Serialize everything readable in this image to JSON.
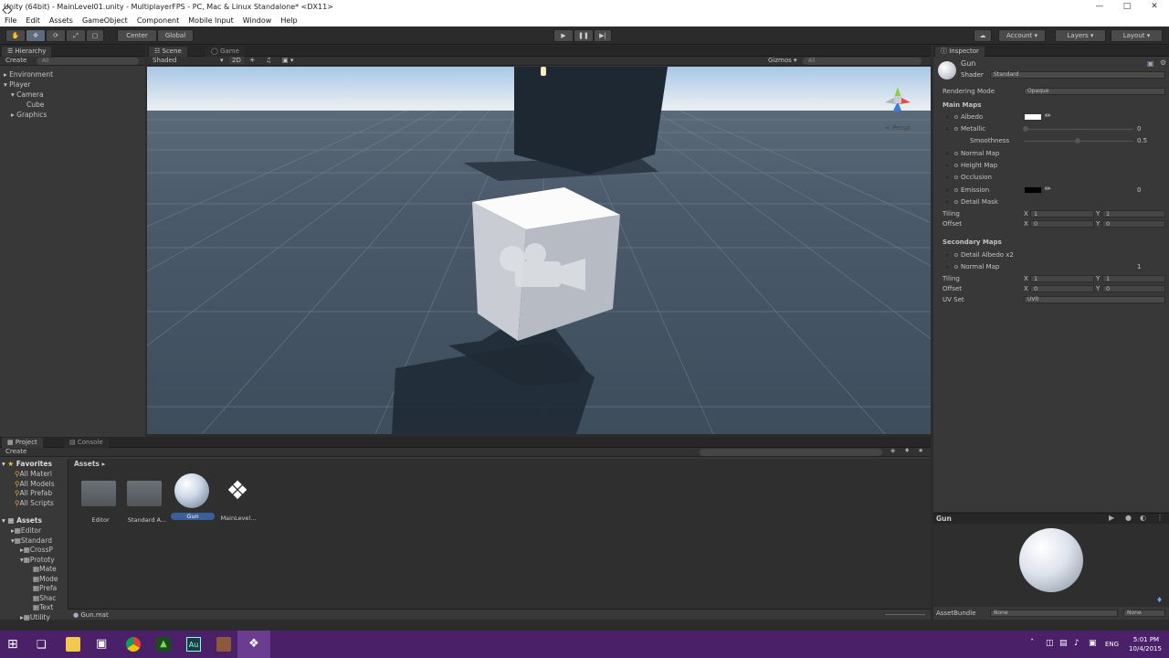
{
  "window": {
    "title": "Unity (64bit) - MainLevel01.unity - MultiplayerFPS - PC, Mac & Linux Standalone* <DX11>"
  },
  "menu": [
    "File",
    "Edit",
    "Assets",
    "GameObject",
    "Component",
    "Mobile Input",
    "Window",
    "Help"
  ],
  "toolbar": {
    "center_label": "Center",
    "global_label": "Global",
    "account_label": "Account",
    "layers_label": "Layers",
    "layout_label": "Layout"
  },
  "hierarchy": {
    "tab": "Hierarchy",
    "create": "Create",
    "search_placeholder": "All",
    "items": [
      "Environment",
      "Player",
      "Camera",
      "Cube",
      "Graphics"
    ]
  },
  "scene": {
    "tab_scene": "Scene",
    "tab_game": "Game",
    "shading": "Shaded",
    "mode_2d": "2D",
    "gizmos": "Gizmos",
    "gizmos_search": "All",
    "persp": "< Persp"
  },
  "inspector": {
    "tab": "Inspector",
    "name": "Gun",
    "shader_label": "Shader",
    "shader_value": "Standard",
    "rendering_mode_label": "Rendering Mode",
    "rendering_mode_value": "Opaque",
    "main_maps": "Main Maps",
    "albedo": "Albedo",
    "metallic": "Metallic",
    "metallic_value": "0",
    "smoothness": "Smoothness",
    "smoothness_value": "0.5",
    "normal_map": "Normal Map",
    "height_map": "Height Map",
    "occlusion": "Occlusion",
    "emission": "Emission",
    "emission_value": "0",
    "detail_mask": "Detail Mask",
    "tiling": "Tiling",
    "offset": "Offset",
    "tiling_x": "1",
    "tiling_y": "1",
    "offset_x": "0",
    "offset_y": "0",
    "secondary_maps": "Secondary Maps",
    "detail_albedo": "Detail Albedo x2",
    "normal_map2": "Normal Map",
    "normal_map2_value": "1",
    "tiling2_x": "1",
    "tiling2_y": "1",
    "offset2_x": "0",
    "offset2_y": "0",
    "uv_set_label": "UV Set",
    "uv_set_value": "UV0",
    "x_label": "X",
    "y_label": "Y",
    "preview_label": "Gun",
    "assetbundle_label": "AssetBundle",
    "assetbundle_value": "None",
    "assetbundle_variant": "None"
  },
  "project": {
    "tab_project": "Project",
    "tab_console": "Console",
    "create": "Create",
    "favorites_label": "Favorites",
    "favorites": [
      "All Materi",
      "All Models",
      "All Prefab",
      "All Scripts"
    ],
    "assets_label": "Assets",
    "tree": [
      "Editor",
      "Standard",
      "CrossP",
      "Prototy",
      "Mate",
      "Mode",
      "Prefa",
      "Shac",
      "Text",
      "Utility"
    ],
    "breadcrumb": "Assets",
    "grid_items": [
      "Editor",
      "Standard A...",
      "Gun",
      "MainLevel..."
    ],
    "footer_file": "Gun.mat"
  },
  "taskbar": {
    "lang": "ENG",
    "time": "5:01 PM",
    "date": "10/4/2015"
  }
}
